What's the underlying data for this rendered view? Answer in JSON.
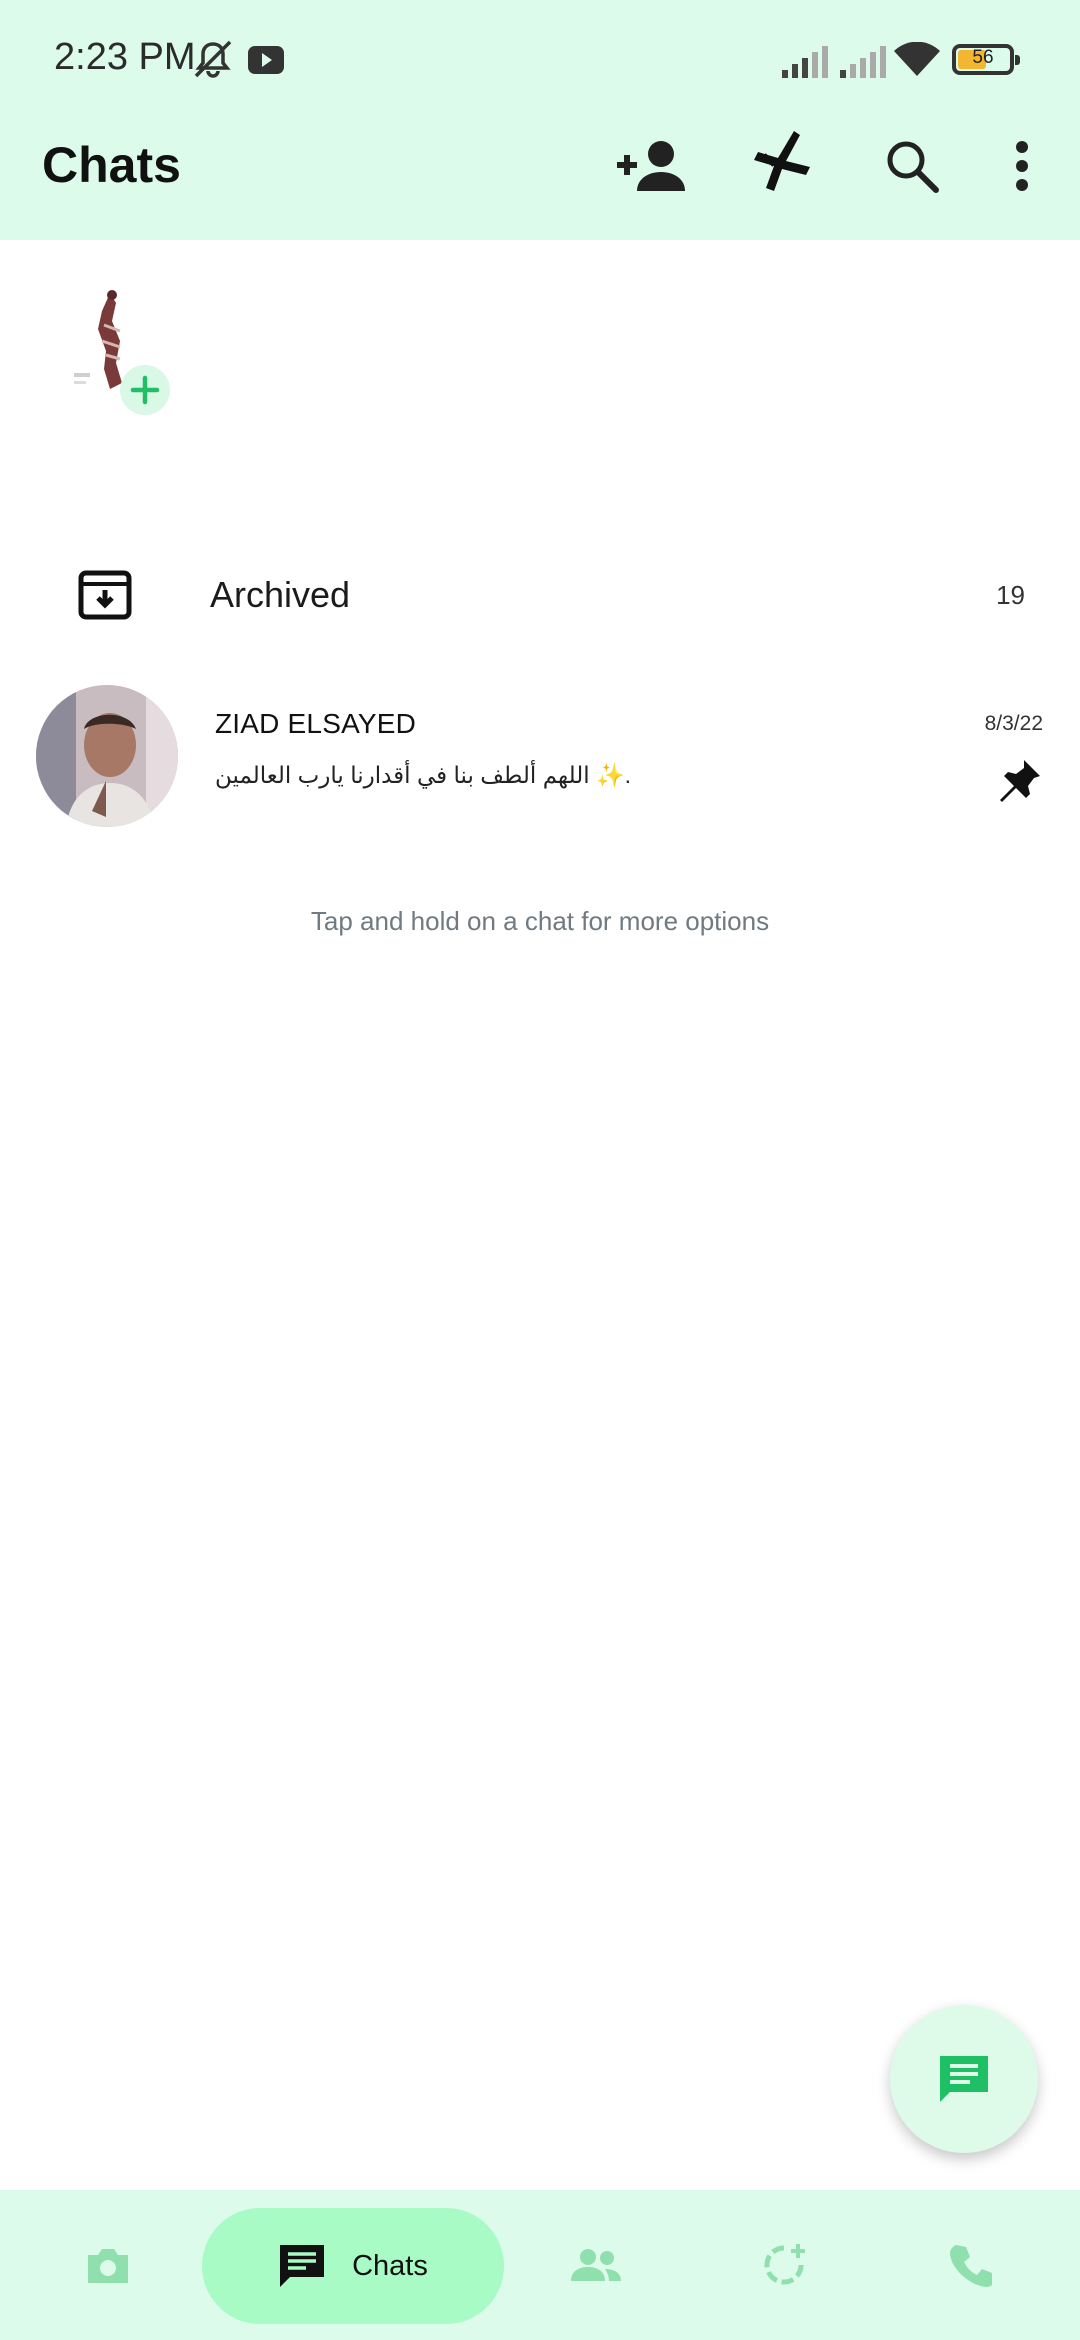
{
  "status_bar": {
    "time": "2:23 PM",
    "battery_level": 56,
    "battery_text": "56"
  },
  "header": {
    "title": "Chats",
    "icons": [
      "add-contact-icon",
      "app-logo-icon",
      "search-icon",
      "more-icon"
    ]
  },
  "status": {
    "add_icon": "plus-icon"
  },
  "archived": {
    "label": "Archived",
    "count": "19"
  },
  "chats": [
    {
      "name": "ZIAD ELSAYED",
      "message": "اللهم ألطف بنا في أقدارنا يارب العالمين ✨.",
      "date": "8/3/22",
      "pinned": true
    }
  ],
  "hint": "Tap and hold on a chat for more options",
  "bottom_nav": {
    "items": [
      {
        "icon": "camera-icon"
      },
      {
        "icon": "chat-icon",
        "label": "Chats",
        "active": true
      },
      {
        "icon": "groups-icon"
      },
      {
        "icon": "status-icon"
      },
      {
        "icon": "phone-icon"
      }
    ]
  },
  "colors": {
    "header_bg": "#dcfbea",
    "accent": "#1fbf66",
    "nav_active": "#a8fbc4",
    "nav_icon": "#8fe0ad"
  }
}
